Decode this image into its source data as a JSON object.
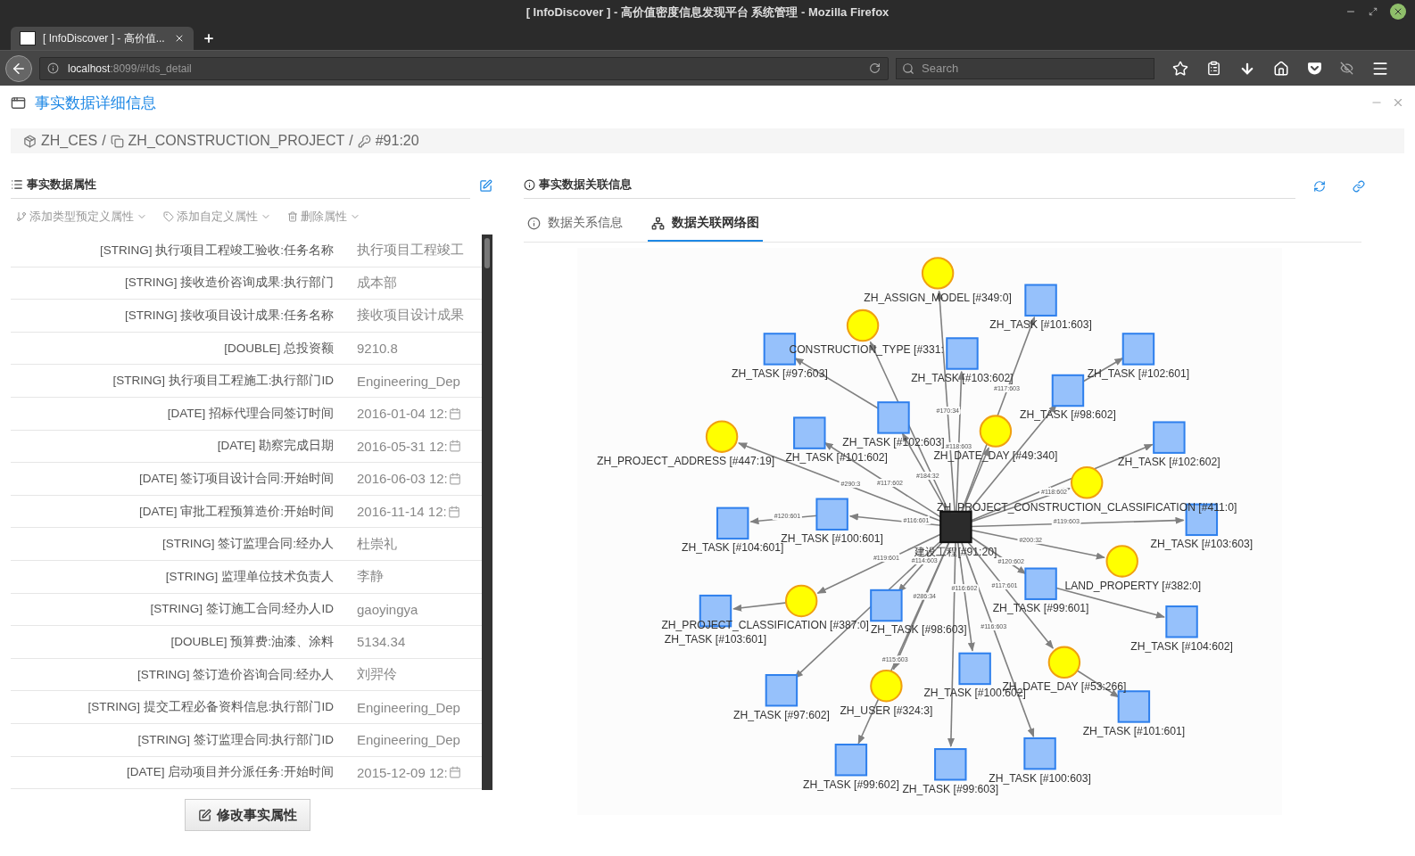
{
  "browser": {
    "window_title": "[ InfoDiscover ] - 高价值密度信息发现平台 系统管理 - Mozilla Firefox",
    "tab": {
      "title": "[ InfoDiscover ] - 高价值...",
      "selected": true
    },
    "url": {
      "host": "localhost",
      "rest": ":8099/#!ds_detail"
    },
    "search": {
      "placeholder": "Search"
    }
  },
  "page": {
    "title": "事实数据详细信息"
  },
  "breadcrumb": {
    "separator": "/",
    "items": [
      {
        "kind": "space",
        "label": "ZH_CES"
      },
      {
        "kind": "type",
        "label": "ZH_CONSTRUCTION_PROJECT"
      },
      {
        "kind": "record",
        "label": "#91:20"
      }
    ]
  },
  "properties_panel": {
    "title": "事实数据属性",
    "actions": [
      {
        "kind": "predefined",
        "label": "添加类型预定义属性"
      },
      {
        "kind": "custom",
        "label": "添加自定义属性"
      },
      {
        "kind": "delete",
        "label": "删除属性"
      }
    ],
    "rows": [
      {
        "kind": "text",
        "name": "[STRING] 执行项目工程竣工验收:任务名称",
        "value": "执行项目工程竣工"
      },
      {
        "kind": "text",
        "name": "[STRING] 接收造价咨询成果:执行部门",
        "value": "成本部"
      },
      {
        "kind": "text",
        "name": "[STRING] 接收项目设计成果:任务名称",
        "value": "接收项目设计成果"
      },
      {
        "kind": "text",
        "name": "[DOUBLE] 总投资额",
        "value": "9210.8"
      },
      {
        "kind": "text",
        "name": "[STRING] 执行项目工程施工:执行部门ID",
        "value": "Engineering_Dep"
      },
      {
        "kind": "date",
        "name": "[DATE] 招标代理合同签订时间",
        "value": "2016-01-04 12:"
      },
      {
        "kind": "date",
        "name": "[DATE] 勘察完成日期",
        "value": "2016-05-31 12:"
      },
      {
        "kind": "date",
        "name": "[DATE] 签订项目设计合同:开始时间",
        "value": "2016-06-03 12:"
      },
      {
        "kind": "date",
        "name": "[DATE] 审批工程预算造价:开始时间",
        "value": "2016-11-14 12:"
      },
      {
        "kind": "text",
        "name": "[STRING] 签订监理合同:经办人",
        "value": "杜崇礼"
      },
      {
        "kind": "text",
        "name": "[STRING] 监理单位技术负责人",
        "value": "李静"
      },
      {
        "kind": "text",
        "name": "[STRING] 签订施工合同:经办人ID",
        "value": "gaoyingya"
      },
      {
        "kind": "text",
        "name": "[DOUBLE] 预算费:油漆、涂料",
        "value": "5134.34"
      },
      {
        "kind": "text",
        "name": "[STRING] 签订造价咨询合同:经办人",
        "value": "刘羿伶"
      },
      {
        "kind": "text",
        "name": "[STRING] 提交工程必备资料信息:执行部门ID",
        "value": "Engineering_Dep"
      },
      {
        "kind": "text",
        "name": "[STRING] 签订监理合同:执行部门ID",
        "value": "Engineering_Dep"
      },
      {
        "kind": "date",
        "name": "[DATE] 启动项目并分派任务:开始时间",
        "value": "2015-12-09 12:"
      }
    ],
    "button": "修改事实属性"
  },
  "relations_panel": {
    "title": "事实数据关联信息",
    "tabs": [
      {
        "kind": "info",
        "label": "数据关系信息",
        "selected": false
      },
      {
        "kind": "graph",
        "label": "数据关联网络图",
        "selected": true
      }
    ],
    "graph": {
      "center": {
        "label": "建设工程[#91:20]"
      },
      "nodes": [
        {
          "kind": "dimension",
          "label": "ZH_ASSIGN_MODEL [#349:0]",
          "edge_label": "#170:34"
        },
        {
          "kind": "task",
          "label": "ZH_TASK [#101:603]",
          "edge_label": "#117:603"
        },
        {
          "kind": "dimension",
          "label": "CONSTRUCTION_TYPE [#331:"
        },
        {
          "kind": "task",
          "label": "ZH_TASK [#97:603]"
        },
        {
          "kind": "task",
          "label": "ZH_TASK [#103:602]",
          "edge_label": "#118:603"
        },
        {
          "kind": "task",
          "label": "ZH_TASK [#102:601]"
        },
        {
          "kind": "task",
          "label": "ZH_TASK [#98:602]"
        },
        {
          "kind": "task",
          "label": "ZH_TASK [#102:603]",
          "edge_label": "#184:32"
        },
        {
          "kind": "dimension",
          "label": "ZH_DATE_DAY [#49:340]"
        },
        {
          "kind": "dimension",
          "label": "ZH_PROJECT_ADDRESS [#447:19]",
          "edge_label": "#290:3"
        },
        {
          "kind": "task",
          "label": "ZH_TASK [#101:602]",
          "edge_label": "#117:602"
        },
        {
          "kind": "task",
          "label": "ZH_TASK [#102:602]"
        },
        {
          "kind": "dimension",
          "label": "ZH_PROJECT_CONSTRUCTION_CLASSIFICATION [#411:0]",
          "edge_label": "#118:602"
        },
        {
          "kind": "task",
          "label": "ZH_TASK [#104:601]",
          "edge_label": "#120:601"
        },
        {
          "kind": "task",
          "label": "ZH_TASK [#100:601]",
          "edge_label": "#116:601"
        },
        {
          "kind": "task",
          "label": "ZH_TASK [#103:603]",
          "edge_label": "#119:603"
        },
        {
          "kind": "dimension",
          "label": "LAND_PROPERTY [#382:0]",
          "edge_label": "#200:32"
        },
        {
          "kind": "task",
          "label": "ZH_TASK [#99:601]",
          "edge_label": "#120:602"
        },
        {
          "kind": "task",
          "label": "ZH_TASK [#104:602]"
        },
        {
          "kind": "dimension",
          "label": "ZH_PROJECT_CLASSIFICATION [#387:0]",
          "edge_label": "#119:601"
        },
        {
          "kind": "task",
          "label": "ZH_TASK [#103:601]"
        },
        {
          "kind": "task",
          "label": "ZH_TASK [#98:603]",
          "edge_label": "#114:603"
        },
        {
          "kind": "dimension",
          "label": "ZH_DATE_DAY [#53:266]",
          "edge_label": "#117:601"
        },
        {
          "kind": "task",
          "label": "ZH_TASK [#100:602]",
          "edge_label": "#116:602"
        },
        {
          "kind": "dimension",
          "label": "ZH_USER [#324:3]",
          "edge_label": "#286:34"
        },
        {
          "kind": "task",
          "label": "ZH_TASK [#97:602]"
        },
        {
          "kind": "task",
          "label": "ZH_TASK [#101:601]"
        },
        {
          "kind": "task",
          "label": "ZH_TASK [#99:602]",
          "edge_label": "#115:603"
        },
        {
          "kind": "task",
          "label": "ZH_TASK [#99:603]"
        },
        {
          "kind": "task",
          "label": "ZH_TASK [#100:603]",
          "edge_label": "#116:603"
        }
      ]
    }
  }
}
